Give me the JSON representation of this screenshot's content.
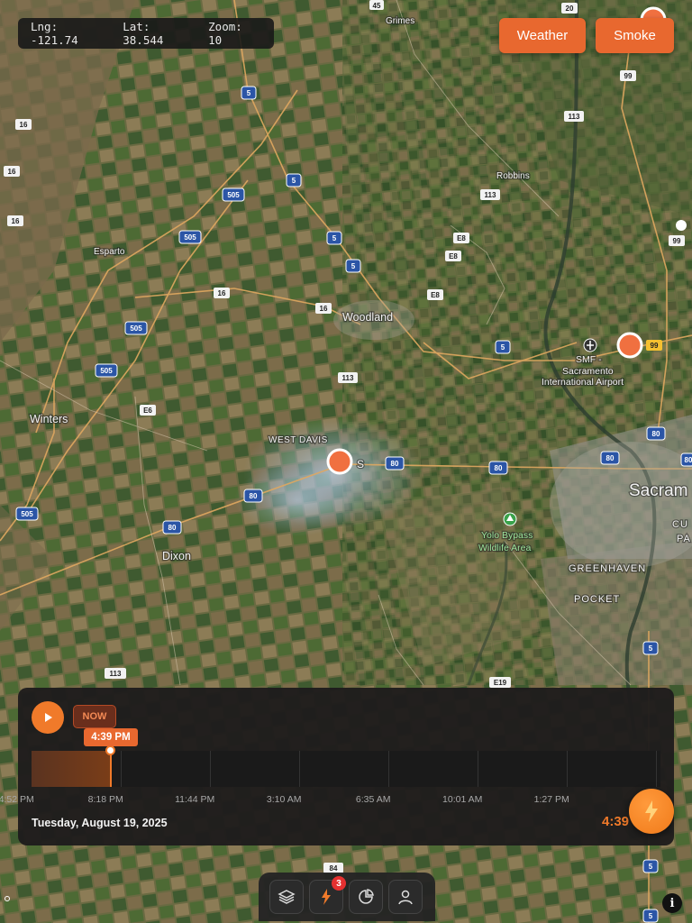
{
  "coords": {
    "lng": "Lng: -121.74",
    "lat": "Lat: 38.544",
    "zoom": "Zoom: 10"
  },
  "buttons": {
    "weather": "Weather",
    "smoke": "Smoke"
  },
  "map": {
    "places": [
      {
        "name": "Grimes"
      },
      {
        "name": "Robbins"
      },
      {
        "name": "Esparto"
      },
      {
        "name": "Woodland"
      },
      {
        "name": "Winters"
      },
      {
        "name": "WEST DAVIS"
      },
      {
        "name": "Dixon"
      },
      {
        "name": "SMF -"
      },
      {
        "name": "Sacramento"
      },
      {
        "name": "International Airport"
      },
      {
        "name": "Yolo Bypass"
      },
      {
        "name": "Wildlife Area"
      },
      {
        "name": "Sacram"
      },
      {
        "name": "GREENHAVEN"
      },
      {
        "name": "POCKET"
      },
      {
        "name": "CU"
      },
      {
        "name": "PA"
      },
      {
        "name": "S"
      }
    ],
    "shields": [
      "45",
      "20",
      "99",
      "113",
      "16",
      "16",
      "16",
      "5",
      "5",
      "505",
      "505",
      "5",
      "5",
      "E8",
      "E8",
      "E8",
      "16",
      "16",
      "505",
      "505",
      "113",
      "5",
      "99",
      "99",
      "E6",
      "80",
      "80",
      "80",
      "80",
      "80",
      "80",
      "505",
      "80",
      "113",
      "E19",
      "5",
      "84",
      "5",
      "5"
    ],
    "fire_markers": 3
  },
  "timeline": {
    "now_label": "NOW",
    "current_time": "4:39 PM",
    "ticks": [
      "4:52 PM",
      "8:18 PM",
      "11:44 PM",
      "3:10 AM",
      "6:35 AM",
      "10:01 AM",
      "1:27 PM",
      "4:5"
    ],
    "progress": 0.126,
    "date": "Tuesday, August 19, 2025",
    "time_display": "4:39"
  },
  "nav": {
    "badge_count": "3"
  },
  "colors": {
    "accent": "#e8682f",
    "panel": "#1e1c1c",
    "badge": "#e53030"
  }
}
